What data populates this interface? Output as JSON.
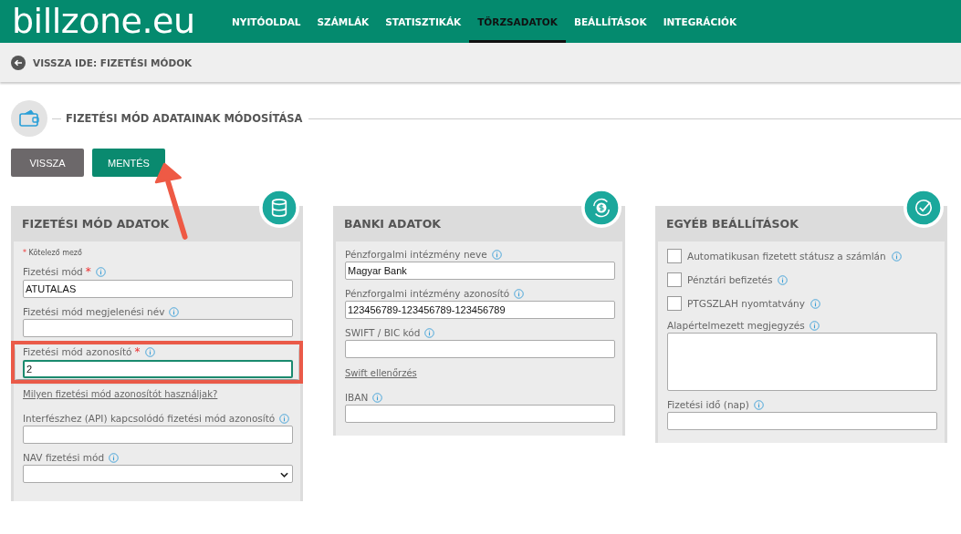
{
  "logo": "billzone.eu",
  "nav": [
    {
      "label": "NYITÓOLDAL",
      "selected": false
    },
    {
      "label": "SZÁMLÁK",
      "selected": false
    },
    {
      "label": "STATISZTIKÁK",
      "selected": false
    },
    {
      "label": "TÖRZSADATOK",
      "selected": true
    },
    {
      "label": "BEÁLLÍTÁSOK",
      "selected": false
    },
    {
      "label": "INTEGRÁCIÓK",
      "selected": false
    }
  ],
  "back_link": "VISSZA IDE: FIZETÉSI MÓDOK",
  "page_title": "FIZETÉSI MÓD ADATAINAK MÓDOSÍTÁSA",
  "buttons": [
    {
      "label": "VISSZA",
      "kind": "secondary"
    },
    {
      "label": "MENTÉS",
      "kind": "primary"
    }
  ],
  "annotation_arrow": true,
  "panels": [
    {
      "title": "FIZETÉSI MÓD ADATOK",
      "fields": [
        {
          "kind": "note",
          "mark": "*",
          "label": "Kötelező mező"
        },
        {
          "kind": "text",
          "label": "Fizetési mód",
          "mark": "*",
          "value": "ATUTALAS",
          "highlighted": false
        },
        {
          "kind": "text",
          "label": "Fizetési mód megjelenési név",
          "highlighted": false
        },
        {
          "kind": "text",
          "label": "Fizetési mód azonosító",
          "mark": "*",
          "value": "2",
          "highlighted": true
        },
        {
          "kind": "link",
          "label": "Milyen fizetési mód azonosítót használjak?"
        },
        {
          "kind": "text",
          "label": "Interfészhez (API) kapcsolódó fizetési mód azonosító",
          "highlighted": false
        },
        {
          "kind": "select",
          "label": "NAV fizetési mód",
          "highlighted": false
        }
      ]
    },
    {
      "title": "BANKI ADATOK",
      "fields": [
        {
          "kind": "text",
          "label": "Pénzforgalmi intézmény neve",
          "value": "Magyar Bank",
          "highlighted": false
        },
        {
          "kind": "text",
          "label": "Pénzforgalmi intézmény azonosító",
          "value": "123456789-123456789-123456789",
          "highlighted": false
        },
        {
          "kind": "text",
          "label": "SWIFT / BIC kód",
          "highlighted": false
        },
        {
          "kind": "link",
          "label": "Swift ellenőrzés"
        },
        {
          "kind": "text",
          "label": "IBAN",
          "highlighted": false
        }
      ]
    },
    {
      "title": "EGYÉB BEÁLLÍTÁSOK",
      "fields": [
        {
          "kind": "checkbox",
          "label": "Automatikusan fizetett státusz a számlán",
          "checked": false
        },
        {
          "kind": "checkbox",
          "label": "Pénztári befizetés",
          "checked": false
        },
        {
          "kind": "checkbox",
          "label": "PTGSZLAH nyomtatvány",
          "checked": false
        },
        {
          "kind": "textarea",
          "label": "Alapértelmezett megjegyzés",
          "highlighted": false
        },
        {
          "kind": "text",
          "label": "Fizetési idő (nap)",
          "highlighted": false
        }
      ]
    }
  ]
}
